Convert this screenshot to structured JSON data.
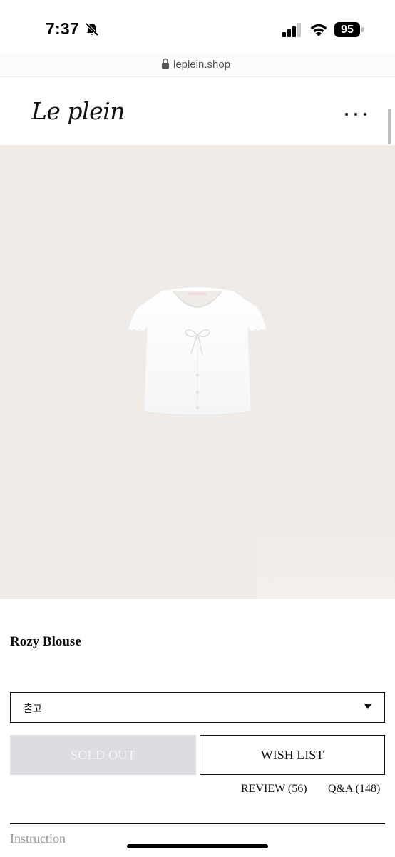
{
  "status_bar": {
    "time": "7:37",
    "battery": "95",
    "icons": [
      "bell-off-icon",
      "signal-icon",
      "wifi-icon",
      "battery-icon"
    ]
  },
  "browser": {
    "url": "leplein.shop",
    "icon": "lock-icon"
  },
  "header": {
    "logo": "Le plein",
    "menu_icon": "more-dots-icon"
  },
  "product": {
    "name": "Rozy Blouse",
    "image_icon": "blouse-image",
    "option": {
      "selected": "출고"
    },
    "sold_out_label": "SOLD OUT",
    "wish_list_label": "WISH LIST",
    "review_label": "REVIEW (56)",
    "qa_label": "Q&A (148)",
    "instruction_label": "Instruction"
  },
  "colors": {
    "hero_bg": "#f0ebe6",
    "sold_out_bg": "#dcdde1",
    "text": "#111111",
    "muted": "#999999"
  }
}
